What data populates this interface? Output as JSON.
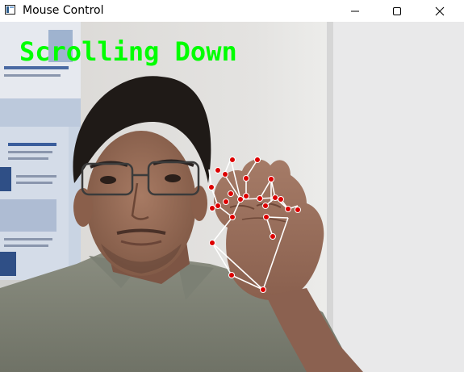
{
  "window": {
    "title": "Mouse Control",
    "icon": "app-window-icon",
    "controls": [
      "minimize-icon",
      "maximize-icon",
      "close-icon"
    ]
  },
  "overlay": {
    "status_text": "Scrolling Down",
    "status_color": "#00ff00",
    "landmark_color": "#e00000",
    "connection_color": "#ffffff"
  }
}
